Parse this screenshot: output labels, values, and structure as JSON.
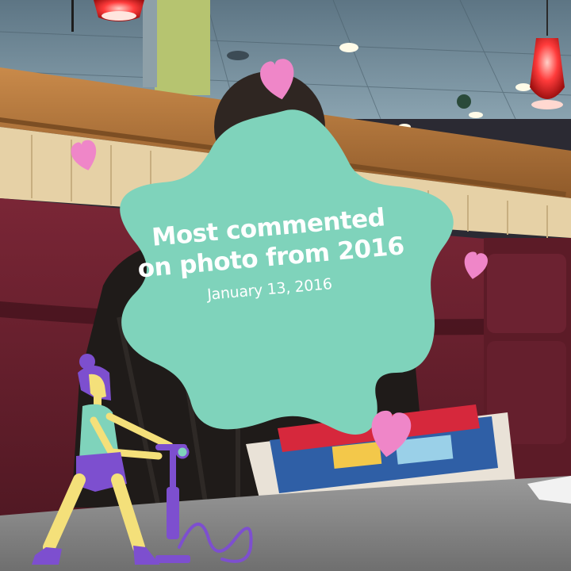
{
  "card": {
    "title": "Most commented on photo from 2016",
    "date": "January 13, 2016"
  },
  "colors": {
    "star": "#7fd3bb",
    "heart": "#ef86c8",
    "figure_purple": "#7d4fcf",
    "figure_yellow": "#f4e07a",
    "booth_red": "#6e2130",
    "wood": "#b0743a",
    "ceiling": "#6d8796"
  },
  "icons": [
    "heart-icon",
    "star-badge",
    "bicycle-pump-illustration",
    "person-illustration"
  ]
}
